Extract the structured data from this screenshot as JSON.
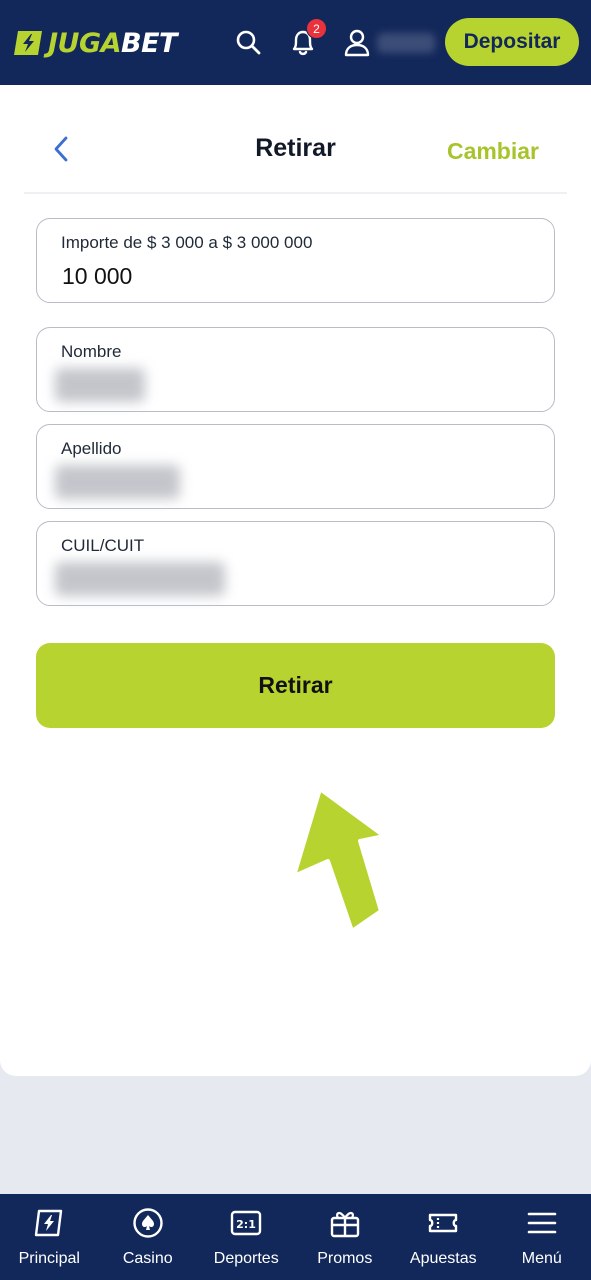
{
  "header": {
    "logo_part1": "JUGA",
    "logo_part2": "BET",
    "notifications_count": "2",
    "deposit_label": "Depositar"
  },
  "withdraw": {
    "title": "Retirar",
    "change_label": "Cambiar",
    "amount_label": "Importe de $ 3 000 a $ 3 000 000",
    "amount_value": "10 000",
    "first_name_label": "Nombre",
    "last_name_label": "Apellido",
    "cuil_label": "CUIL/CUIT",
    "submit_label": "Retirar"
  },
  "nav": {
    "items": [
      {
        "label": "Principal",
        "icon": "lightning-icon"
      },
      {
        "label": "Casino",
        "icon": "spade-chip-icon"
      },
      {
        "label": "Deportes",
        "icon": "scoreboard-icon"
      },
      {
        "label": "Promos",
        "icon": "gift-icon"
      },
      {
        "label": "Apuestas",
        "icon": "ticket-icon"
      },
      {
        "label": "Menú",
        "icon": "hamburger-icon"
      }
    ]
  },
  "colors": {
    "brand_navy": "#13285a",
    "accent_lime": "#b7d330",
    "badge_red": "#e8323c"
  }
}
